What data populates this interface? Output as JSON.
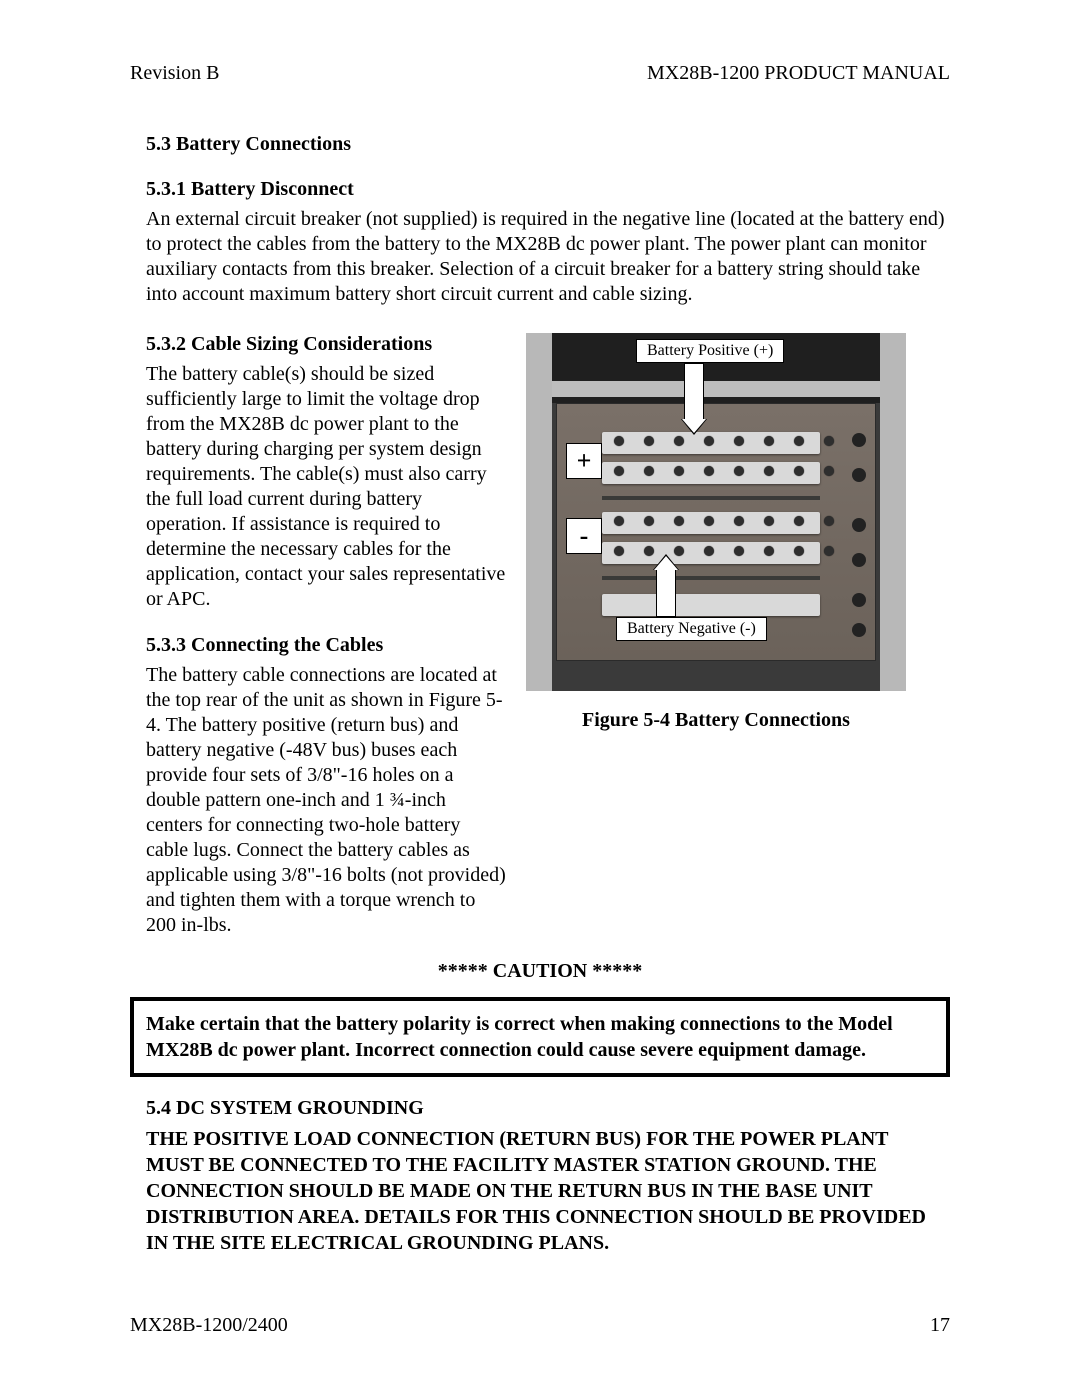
{
  "header": {
    "left": "Revision B",
    "right": "MX28B-1200   PRODUCT MANUAL"
  },
  "sections": {
    "s53": "5.3  Battery Connections",
    "s531": "5.3.1  Battery Disconnect",
    "s531_body": "An external circuit breaker (not supplied) is required in the negative line (located at the battery end) to protect the cables from the battery to the MX28B dc power plant.  The power plant can monitor auxiliary contacts from this breaker.  Selection of a circuit breaker for a battery string should take into account maximum battery short circuit current and cable sizing.",
    "s532": "5.3.2  Cable Sizing Considerations",
    "s532_body": "The battery cable(s) should be sized sufficiently large to limit the voltage drop from the MX28B dc power plant to the battery during charging per system design requirements.  The cable(s) must also carry the full load current during battery operation.  If assistance is required to determine the necessary cables for the application, contact your sales representative or APC.",
    "s533": "5.3.3  Connecting the Cables",
    "s533_body": "The battery cable connections are located at the top rear of the unit as shown in Figure 5-4.  The battery positive (return bus) and battery negative (-48V bus) buses each provide four sets of 3/8\"-16 holes on a double pattern one-inch and 1 ¾-inch centers for connecting two-hole battery cable lugs.  Connect the battery cables as applicable using 3/8\"-16 bolts (not provided) and tighten them with a torque wrench to 200 in-lbs.",
    "caution_h": "*****   CAUTION   *****",
    "caution_body": "Make certain that the battery polarity is correct when making connections to the Model MX28B dc power plant.  Incorrect connection could cause severe equipment damage.",
    "s54": "5.4  DC SYSTEM GROUNDING",
    "s54_body": "THE POSITIVE LOAD CONNECTION (RETURN BUS) FOR THE POWER PLANT MUST BE CONNECTED TO THE FACILITY MASTER STATION GROUND.   THE CONNECTION SHOULD BE MADE ON THE RETURN BUS IN THE BASE UNIT DISTRIBUTION AREA.  DETAILS FOR THIS CONNECTION SHOULD BE PROVIDED IN THE SITE ELECTRICAL GROUNDING PLANS."
  },
  "figure": {
    "caption": "Figure 5-4  Battery Connections",
    "label_pos": "Battery Positive (+)",
    "label_neg": "Battery Negative (-)",
    "plus": "+",
    "minus": "-"
  },
  "footer": {
    "left": "MX28B-1200/2400",
    "right": "17"
  }
}
